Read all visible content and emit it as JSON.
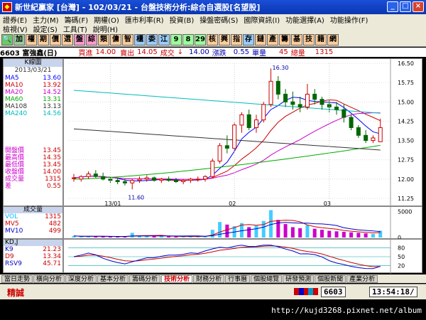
{
  "window": {
    "title": "新世紀贏家 [台灣] - 102/03/21 - 台盤技術分析:綜合自選股[名望股]"
  },
  "menu1": [
    "證券(E)",
    "主力(M)",
    "籌碼(F)",
    "期權(O)",
    "匯市利率(R)",
    "投資(B)",
    "操盤密碼(S)",
    "國際資訊(I)",
    "功能選擇(A)",
    "功能操作(F)"
  ],
  "menu2": [
    "檢視(V)",
    "設定(S)",
    "工具(T)",
    "說明(H)"
  ],
  "toolbar": [
    "加",
    "權",
    "期",
    "價",
    "選",
    "盤",
    "綜",
    "類",
    "傭",
    "智",
    "櫃",
    "委",
    "江",
    "9",
    "8",
    "29",
    "核",
    "興",
    "指",
    "存",
    "鏈",
    "產",
    "籌",
    "基",
    "技",
    "籍",
    "網"
  ],
  "quote": {
    "code_name": "6603 富強鑫(日)",
    "buy_label": "買進",
    "buy": "14.00",
    "sell_label": "賣出",
    "sell": "14.05",
    "deal_label": "成交",
    "deal_arrow": "↓",
    "deal": "14.00",
    "change_label": "漲跌",
    "change": "0.55",
    "volume_label": "單量",
    "volume": "45",
    "total_label": "總量",
    "total": "1315"
  },
  "leftpanel": {
    "head": "K線圖",
    "date": "2013/03/21",
    "ma": [
      {
        "label": "MA5",
        "value": "13.60",
        "color": "#0000ff"
      },
      {
        "label": "MA10",
        "value": "13.92",
        "color": "#cc0000"
      },
      {
        "label": "MA20",
        "value": "14.52",
        "color": "#cc00cc"
      },
      {
        "label": "MA60",
        "value": "13.31",
        "color": "#00aa00"
      },
      {
        "label": "MA108",
        "value": "13.13",
        "color": "#333333"
      },
      {
        "label": "MA240",
        "value": "14.56",
        "color": "#00bbbb"
      }
    ],
    "prices": [
      {
        "label": "開盤價",
        "value": "13.45"
      },
      {
        "label": "最高價",
        "value": "14.35"
      },
      {
        "label": "最低價",
        "value": "13.45"
      },
      {
        "label": "收盤價",
        "value": "14.00"
      },
      {
        "label": "成交量",
        "value": "1315"
      },
      {
        "label": "差",
        "value": "0.55"
      }
    ]
  },
  "chart": {
    "yticks": [
      "16.50",
      "15.75",
      "15.00",
      "14.25",
      "13.50",
      "12.75",
      "12.00",
      "11.25"
    ],
    "xticks": [
      "13/01",
      "02",
      "03"
    ],
    "high_label": "16.30",
    "low_label": "11.60"
  },
  "chart_data": {
    "type": "candlestick",
    "ylim": [
      11.25,
      16.5
    ],
    "candles": [
      [
        12.05,
        12.2,
        11.9,
        12.05
      ],
      [
        12.0,
        12.15,
        11.9,
        12.1
      ],
      [
        12.1,
        12.3,
        12.0,
        12.2
      ],
      [
        12.2,
        12.35,
        12.05,
        12.1
      ],
      [
        12.1,
        12.25,
        11.95,
        12.0
      ],
      [
        12.0,
        12.1,
        11.85,
        11.95
      ],
      [
        11.95,
        12.05,
        11.8,
        11.9
      ],
      [
        11.9,
        12.0,
        11.75,
        11.85
      ],
      [
        11.85,
        12.0,
        11.6,
        11.95
      ],
      [
        11.95,
        12.1,
        11.85,
        12.0
      ],
      [
        12.0,
        12.15,
        11.9,
        12.05
      ],
      [
        12.05,
        12.1,
        11.9,
        11.95
      ],
      [
        11.95,
        12.05,
        11.85,
        12.0
      ],
      [
        12.0,
        12.1,
        11.9,
        11.95
      ],
      [
        11.95,
        12.05,
        11.85,
        11.9
      ],
      [
        11.9,
        12.0,
        11.8,
        11.95
      ],
      [
        11.95,
        12.05,
        11.85,
        12.0
      ],
      [
        12.0,
        12.1,
        11.9,
        12.0
      ],
      [
        12.0,
        12.15,
        11.9,
        12.1
      ],
      [
        12.1,
        12.8,
        12.05,
        12.7
      ],
      [
        12.7,
        13.4,
        12.6,
        13.3
      ],
      [
        13.3,
        13.7,
        13.0,
        13.2
      ],
      [
        13.2,
        14.2,
        13.1,
        14.1
      ],
      [
        14.1,
        14.6,
        13.8,
        14.5
      ],
      [
        14.5,
        14.7,
        13.9,
        14.0
      ],
      [
        14.0,
        14.5,
        13.8,
        14.3
      ],
      [
        14.3,
        15.0,
        14.2,
        14.9
      ],
      [
        14.9,
        16.3,
        14.8,
        15.8
      ],
      [
        15.8,
        16.0,
        15.1,
        15.3
      ],
      [
        15.3,
        15.5,
        14.8,
        15.0
      ],
      [
        15.0,
        15.4,
        14.7,
        14.9
      ],
      [
        14.9,
        15.2,
        14.6,
        14.8
      ],
      [
        14.8,
        15.7,
        14.7,
        15.3
      ],
      [
        15.3,
        15.5,
        14.9,
        15.1
      ],
      [
        15.1,
        15.2,
        14.7,
        14.9
      ],
      [
        14.9,
        15.1,
        14.6,
        14.8
      ],
      [
        14.8,
        15.0,
        14.5,
        14.7
      ],
      [
        14.7,
        14.9,
        14.2,
        14.4
      ],
      [
        14.4,
        14.5,
        13.9,
        14.0
      ],
      [
        14.0,
        14.1,
        13.6,
        13.7
      ],
      [
        13.7,
        13.9,
        13.4,
        13.5
      ],
      [
        13.5,
        13.7,
        13.4,
        13.6
      ],
      [
        13.45,
        14.35,
        13.45,
        14.0
      ]
    ],
    "volume": [
      300,
      200,
      250,
      180,
      220,
      150,
      140,
      160,
      900,
      400,
      300,
      260,
      240,
      200,
      180,
      160,
      220,
      260,
      300,
      1500,
      3000,
      2500,
      2200,
      2800,
      2000,
      2300,
      3200,
      5300,
      3400,
      2600,
      2000,
      1800,
      2400,
      1700,
      1500,
      1300,
      1200,
      1100,
      1000,
      900,
      800,
      700,
      1315
    ],
    "vol_yticks": [
      "5000",
      "0"
    ],
    "vol_legend": [
      {
        "label": "VOL",
        "value": "1315",
        "color": "#00bbff"
      },
      {
        "label": "MV5",
        "value": "482",
        "color": "#cc0000"
      },
      {
        "label": "MV10",
        "value": "499",
        "color": "#0000cc"
      }
    ],
    "kd_yticks": [
      "80",
      "50",
      "20"
    ],
    "kd_legend": [
      {
        "label": "K9",
        "value": "21.23",
        "color": "#0000cc"
      },
      {
        "label": "D9",
        "value": "13.34",
        "color": "#cc0000"
      },
      {
        "label": "RSV9",
        "value": "45.71",
        "color": "#0000cc"
      }
    ]
  },
  "vol_head": "成交量",
  "kd_head": "KD,J",
  "tabs": [
    "當日走勢",
    "橫向分析",
    "深度分析",
    "基本分析",
    "籌碼分析",
    "技術分析",
    "財務分析",
    "行事曆",
    "個股總覽",
    "研發預測",
    "個股新聞",
    "產業分析"
  ],
  "active_tab": 5,
  "status": {
    "left": "精誠",
    "code": "6603",
    "time": "13:54:18/"
  },
  "watermark": "http://kujd3268.pixnet.net/album"
}
